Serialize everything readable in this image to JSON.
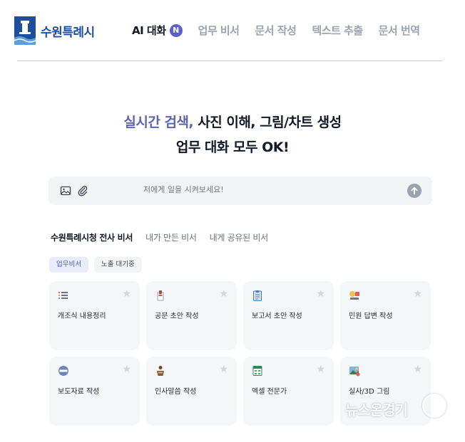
{
  "header": {
    "brand": "수원특례시",
    "nav": [
      {
        "label": "AI 대화",
        "badge": "N",
        "active": true
      },
      {
        "label": "업무 비서"
      },
      {
        "label": "문서 작성"
      },
      {
        "label": "텍스트 추출"
      },
      {
        "label": "문서 번역"
      }
    ]
  },
  "hero": {
    "line1_accent": "실시간 검색,",
    "line1_rest": " 사진 이해, 그림/차트 생성",
    "line2": "업무 대화 모두 OK!"
  },
  "input": {
    "placeholder": "저에게 일을 시켜보세요!",
    "icons": [
      "image-icon",
      "paperclip-icon",
      "send-arrow-icon"
    ]
  },
  "tabs": [
    "수원특례시청 전사 비서",
    "내가 만든 비서",
    "내게 공유된 비서"
  ],
  "chips": [
    "업무비서",
    "노출 대기중"
  ],
  "cards": [
    {
      "label": "개조식 내용정리",
      "icon": "list-icon"
    },
    {
      "label": "공문 초안 작성",
      "icon": "document-stamp-icon"
    },
    {
      "label": "보고서 초안 작성",
      "icon": "clipboard-icon"
    },
    {
      "label": "민원 답변 작성",
      "icon": "chat-response-icon"
    },
    {
      "label": "보도자료 작성",
      "icon": "news-icon"
    },
    {
      "label": "인사말씀 작성",
      "icon": "podium-icon"
    },
    {
      "label": "엑셀 전문가",
      "icon": "spreadsheet-icon"
    },
    {
      "label": "실사/3D 그림",
      "icon": "picture-icon"
    }
  ],
  "watermark": "뉴스온경기",
  "colors": {
    "accent": "#5a64b4",
    "brand": "#1f4e9c",
    "badge": "#5b5fc7"
  }
}
